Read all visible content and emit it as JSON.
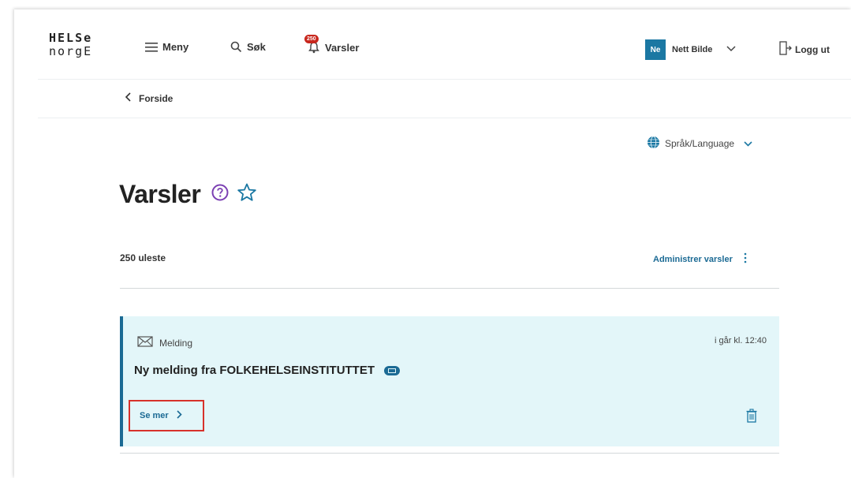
{
  "header": {
    "logo_line1": "HELSe",
    "logo_line2": "norgE",
    "menu_label": "Meny",
    "search_label": "Søk",
    "alerts_label": "Varsler",
    "alerts_badge": "250",
    "user_initials": "Ne",
    "user_name": "Nett Bilde",
    "logout_label": "Logg ut"
  },
  "breadcrumb": {
    "label": "Forside"
  },
  "language": {
    "label": "Språk/Language"
  },
  "page": {
    "title": "Varsler",
    "unread_count": "250 uleste",
    "manage_label": "Administrer varsler"
  },
  "notification": {
    "type_label": "Melding",
    "time": "i går kl. 12:40",
    "title": "Ny melding fra FOLKEHELSEINSTITUTTET",
    "see_more_label": "Se mer"
  },
  "colors": {
    "accent": "#1b6a94",
    "card_bg": "#e3f6f9",
    "badge": "#c8271d",
    "highlight_border": "#d7322b",
    "help_icon": "#7b3fb3"
  }
}
